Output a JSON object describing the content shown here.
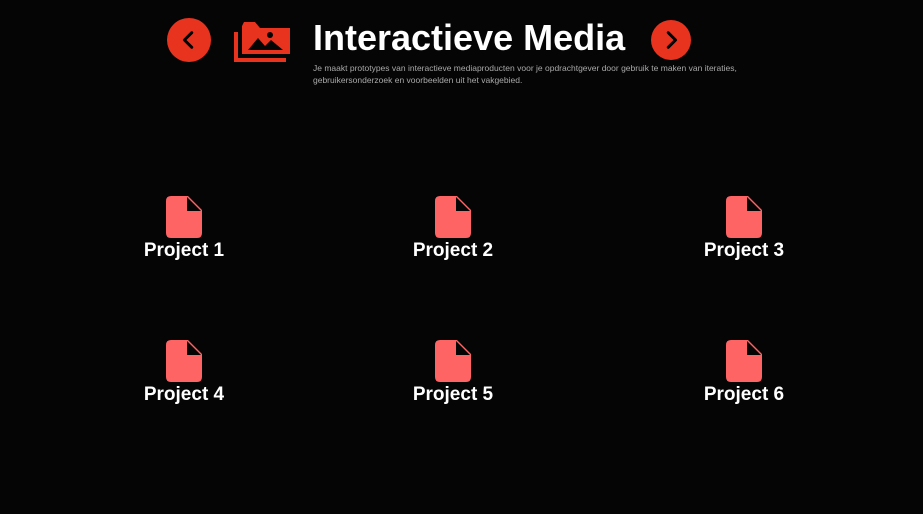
{
  "header": {
    "prev_icon": "chevron-left-icon",
    "next_icon": "chevron-right-icon",
    "section_icon": "photo-library-icon",
    "title": "Interactieve Media",
    "description": "Je maakt prototypes van interactieve mediaproducten voor je opdrachtgever door gebruik te maken van iteraties, gebruikersonderzoek en voorbeelden uit het vakgebied."
  },
  "colors": {
    "background": "#050505",
    "accent": "#e8331f",
    "file_icon": "#ff6464",
    "text": "#ffffff",
    "subtext": "#a9a9a9"
  },
  "projects": [
    {
      "label": "Project 1",
      "icon": "file-icon"
    },
    {
      "label": "Project 2",
      "icon": "file-icon"
    },
    {
      "label": "Project 3",
      "icon": "file-icon"
    },
    {
      "label": "Project 4",
      "icon": "file-icon"
    },
    {
      "label": "Project 5",
      "icon": "file-icon"
    },
    {
      "label": "Project 6",
      "icon": "file-icon"
    }
  ]
}
